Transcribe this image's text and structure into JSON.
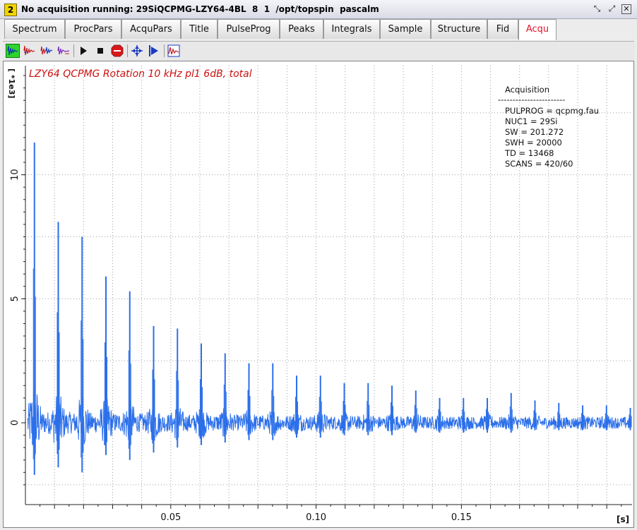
{
  "window": {
    "number": "2",
    "title": "No acquisition running: 29SiQCPMG-LZY64-4BL  8  1  /opt/topspin  pascalm"
  },
  "tabs": [
    {
      "label": "Spectrum"
    },
    {
      "label": "ProcPars"
    },
    {
      "label": "AcquPars"
    },
    {
      "label": "Title"
    },
    {
      "label": "PulseProg"
    },
    {
      "label": "Peaks"
    },
    {
      "label": "Integrals"
    },
    {
      "label": "Sample"
    },
    {
      "label": "Structure"
    },
    {
      "label": "Fid"
    },
    {
      "label": "Acqu",
      "active": true
    }
  ],
  "toolbar": {
    "icons": [
      "fid-green-icon",
      "fid-red-icon",
      "fid-red-blue-icon",
      "fid-multi-icon",
      "play-icon",
      "stop-square-icon",
      "stop-sign-icon",
      "adjust-icon",
      "step-icon",
      "spectrum-window-icon"
    ]
  },
  "colors": {
    "trace": "#2b6fea",
    "title": "#cc1010",
    "active_tab": "#e0142a"
  },
  "info": {
    "heading": "Acquisition",
    "divider": "-----------------------",
    "lines": [
      "PULPROG = qcpmg.fau",
      "NUC1 = 29Si",
      "SW = 201.272",
      "SWH = 20000",
      "TD = 13468",
      "SCANS = 420/60"
    ]
  },
  "chart_data": {
    "type": "line",
    "title": "LZY64 QCPMG Rotation 10 kHz pl1 6dB, total",
    "xlabel": "[s]",
    "ylabel": "[ *1e3]",
    "xlim": [
      0.0,
      0.2087
    ],
    "ylim": [
      -3.3,
      14.4
    ],
    "xticks": [
      0.05,
      0.1,
      0.15
    ],
    "xtick_labels": [
      "0.05",
      "0.10",
      "0.15"
    ],
    "yticks": [
      0,
      5,
      10
    ],
    "ytick_labels": [
      "0",
      "5",
      "10"
    ],
    "grid": true,
    "series": [
      {
        "values": [
          {
            "x": 0.0031,
            "y": 11.3,
            "ymin": -2.1
          },
          {
            "x": 0.0113,
            "y": 8.1,
            "ymin": -1.8
          },
          {
            "x": 0.0195,
            "y": 7.5,
            "ymin": -2.0
          },
          {
            "x": 0.0277,
            "y": 5.9,
            "ymin": -1.3
          },
          {
            "x": 0.0359,
            "y": 5.3,
            "ymin": -1.5
          },
          {
            "x": 0.0441,
            "y": 3.9,
            "ymin": -1.2
          },
          {
            "x": 0.0523,
            "y": 3.8,
            "ymin": -1.0
          },
          {
            "x": 0.0605,
            "y": 3.2,
            "ymin": -0.9
          },
          {
            "x": 0.0687,
            "y": 2.8,
            "ymin": -0.8
          },
          {
            "x": 0.0769,
            "y": 2.4,
            "ymin": -0.7
          },
          {
            "x": 0.0851,
            "y": 2.4,
            "ymin": -0.7
          },
          {
            "x": 0.0933,
            "y": 1.9,
            "ymin": -0.6
          },
          {
            "x": 0.1015,
            "y": 1.9,
            "ymin": -0.6
          },
          {
            "x": 0.1097,
            "y": 1.6,
            "ymin": -0.5
          },
          {
            "x": 0.1179,
            "y": 1.6,
            "ymin": -0.5
          },
          {
            "x": 0.1261,
            "y": 1.5,
            "ymin": -0.5
          },
          {
            "x": 0.1343,
            "y": 1.3,
            "ymin": -0.4
          },
          {
            "x": 0.1425,
            "y": 1.0,
            "ymin": -0.4
          },
          {
            "x": 0.1507,
            "y": 1.0,
            "ymin": -0.4
          },
          {
            "x": 0.1589,
            "y": 1.0,
            "ymin": -0.4
          },
          {
            "x": 0.1671,
            "y": 1.2,
            "ymin": -0.4
          },
          {
            "x": 0.1753,
            "y": 0.9,
            "ymin": -0.3
          },
          {
            "x": 0.1835,
            "y": 0.8,
            "ymin": -0.3
          },
          {
            "x": 0.1917,
            "y": 0.7,
            "ymin": -0.3
          },
          {
            "x": 0.1999,
            "y": 0.7,
            "ymin": -0.3
          },
          {
            "x": 0.2081,
            "y": 0.6,
            "ymin": -0.3
          }
        ],
        "noise_level": 0.35
      }
    ]
  }
}
